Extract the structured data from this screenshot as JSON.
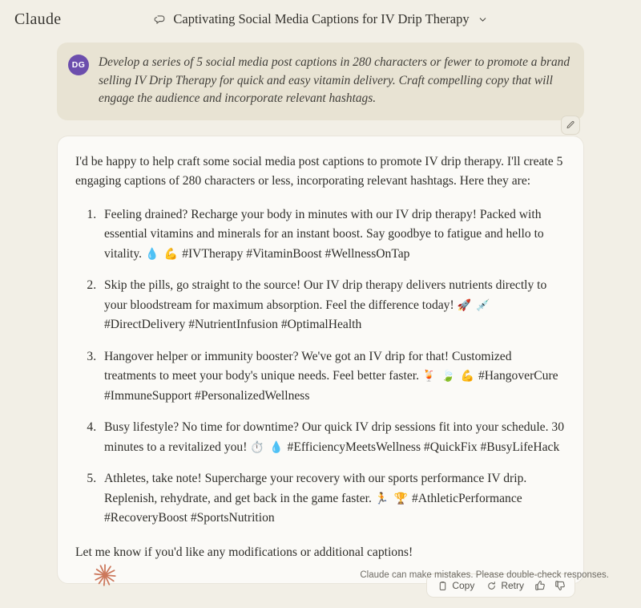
{
  "header": {
    "wordmark": "Claude",
    "chat_icon": "chat-bubble-icon",
    "chat_title": "Captivating Social Media Captions for IV Drip Therapy",
    "chevron_icon": "chevron-down-icon"
  },
  "user_message": {
    "avatar_initials": "DG",
    "avatar_color": "#6c4ead",
    "text": "Develop a series of 5 social media post captions in 280 characters or fewer to promote a brand selling IV Drip Therapy for quick and easy vitamin delivery. Craft compelling copy that will engage the audience and incorporate relevant hashtags.",
    "edit_icon": "pencil-icon"
  },
  "assistant_message": {
    "intro": "I'd be happy to help craft some social media post captions to promote IV drip therapy. I'll create 5 engaging captions of 280 characters or less, incorporating relevant hashtags. Here they are:",
    "captions": [
      {
        "text": "Feeling drained? Recharge your body in minutes with our IV drip therapy! Packed with essential vitamins and minerals for an instant boost. Say goodbye to fatigue and hello to vitality. ",
        "emojis": "💧 💪",
        "hashtags": " #IVTherapy #VitaminBoost #WellnessOnTap"
      },
      {
        "text": "Skip the pills, go straight to the source! Our IV drip therapy delivers nutrients directly to your bloodstream for maximum absorption. Feel the difference today! ",
        "emojis": "🚀 💉",
        "hashtags": " #DirectDelivery #NutrientInfusion #OptimalHealth"
      },
      {
        "text": "Hangover helper or immunity booster? We've got an IV drip for that! Customized treatments to meet your body's unique needs. Feel better faster. ",
        "emojis": "🍹 🍃 💪",
        "hashtags": " #HangoverCure #ImmuneSupport #PersonalizedWellness"
      },
      {
        "text": "Busy lifestyle? No time for downtime? Our quick IV drip sessions fit into your schedule. 30 minutes to a revitalized you! ",
        "emojis": "⏱️ 💧",
        "hashtags": " #EfficiencyMeetsWellness #QuickFix #BusyLifeHack"
      },
      {
        "text": "Athletes, take note! Supercharge your recovery with our sports performance IV drip. Replenish, rehydrate, and get back in the game faster. ",
        "emojis": "🏃 🏆",
        "hashtags": " #AthleticPerformance #RecoveryBoost #SportsNutrition"
      }
    ],
    "outro": "Let me know if you'd like any modifications or additional captions!"
  },
  "action_bar": {
    "copy_label": "Copy",
    "copy_icon": "clipboard-icon",
    "retry_label": "Retry",
    "retry_icon": "refresh-icon",
    "thumbs_up_icon": "thumbs-up-icon",
    "thumbs_down_icon": "thumbs-down-icon"
  },
  "footer": {
    "logo_icon": "claude-starburst-icon",
    "logo_color": "#cc785c",
    "disclaimer": "Claude can make mistakes. Please double-check responses."
  },
  "theme": {
    "page_bg": "#f2efe6",
    "user_bubble_bg": "#e8e3d3",
    "assistant_card_bg": "#fbfaf7",
    "accent": "#cc785c"
  }
}
